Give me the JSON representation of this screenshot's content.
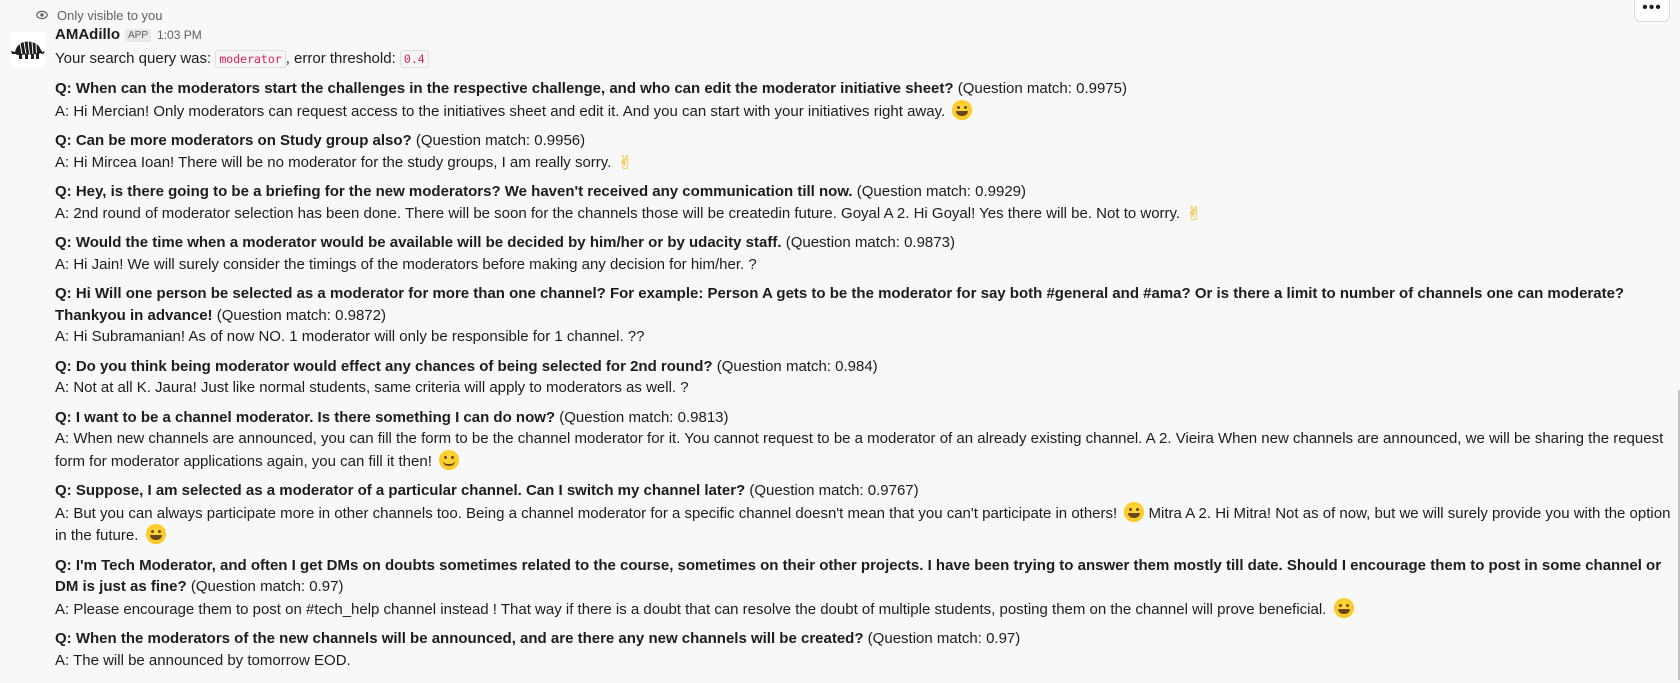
{
  "visibility_note": "Only visible to you",
  "message": {
    "sender": "AMAdillo",
    "badge": "APP",
    "time": "1:03 PM",
    "query_prefix": "Your search query was: ",
    "query_value": "moderator",
    "threshold_prefix": ", error threshold: ",
    "threshold_value": "0.4"
  },
  "more_actions_label": "•••",
  "qa": [
    {
      "q": "Q: When can the moderators start the challenges in the respective challenge, and who can edit the moderator initiative sheet?",
      "match": " (Question match: 0.9975)",
      "a": "A: Hi Mercian! Only moderators can request access to the initiatives sheet and edit it. And you can start with your initiatives right away.",
      "emoji": "grin"
    },
    {
      "q": "Q: Can be more moderators on Study group also?",
      "match": " (Question match: 0.9956)",
      "a": "A: Hi Mircea Ioan! There will be no moderator for the study groups, I am really sorry.",
      "emoji": "victory"
    },
    {
      "q": "Q: Hey, is there going to be a briefing for the new moderators? We haven't received any communication till now.",
      "match": " (Question match: 0.9929)",
      "a": "A: 2nd round of moderator selection has been done. There will be soon for the channels those will be createdin future. Goyal A 2. Hi Goyal! Yes there will be. Not to worry.",
      "emoji": "victory"
    },
    {
      "q": "Q: Would the time when a moderator would be available will be decided by him/her or by udacity staff.",
      "match": " (Question match: 0.9873)",
      "a": "A: Hi Jain! We will surely consider the timings of the moderators before making any decision for him/her. ?",
      "emoji": ""
    },
    {
      "q": "Q: Hi Will one person be selected as a moderator for more than one channel? For example: Person A gets to be the moderator for say both #general and #ama? Or is there a limit to number of channels one can moderate? Thankyou in advance!",
      "match": " (Question match: 0.9872)",
      "a": "A: Hi Subramanian! As of now NO. 1 moderator will only be responsible for 1 channel. ??",
      "emoji": ""
    },
    {
      "q": "Q: Do you think being moderator would effect any chances of being selected for 2nd round?",
      "match": " (Question match: 0.984)",
      "a": "A: Not at all K. Jaura! Just like normal students, same criteria will apply to moderators as well. ?",
      "emoji": ""
    },
    {
      "q": "Q: I want to be a channel moderator. Is there something I can do now?",
      "match": " (Question match: 0.9813)",
      "a": "A: When new channels are announced, you can fill the form to be the channel moderator for it. You cannot request to be a moderator of an already existing channel. A 2. Vieira When new channels are announced, we will be sharing the request form for moderator applications again, you can fill it then!",
      "emoji": "slight"
    },
    {
      "q": "Q: Suppose, I am selected as a moderator of a particular channel. Can I switch my channel later?",
      "match": " (Question match: 0.9767)",
      "a": "A: But you can always participate more in other channels too. Being a channel moderator for a specific channel doesn't mean that you can't participate in others!",
      "a2": " Mitra A 2. Hi Mitra! Not as of now, but we will surely provide you with the option in the future.",
      "emoji": "grin"
    },
    {
      "q": "Q: I'm Tech Moderator, and often I get DMs on doubts sometimes related to the course, sometimes on their other projects. I have been trying to answer them mostly till date. Should I encourage them to post in some channel or DM is just as fine?",
      "match": " (Question match: 0.97)",
      "a": "A: Please encourage them to post on #tech_help channel instead ! That way if there is a doubt that can resolve the doubt of multiple students, posting them on the channel will prove beneficial.",
      "emoji": "grin"
    },
    {
      "q": "Q: When the moderators of the new channels will be announced, and are there any new channels will be created?",
      "match": " (Question match: 0.97)",
      "a": "A: The will be announced by tomorrow EOD.",
      "emoji": ""
    }
  ],
  "icons": {
    "eye": "eye-icon",
    "avatar": "armadillo-avatar",
    "emoji_grin": "grinning-face-emoji",
    "emoji_slight": "slightly-smiling-face-emoji",
    "emoji_victory": "victory-hand-emoji"
  },
  "colors": {
    "code_text": "#e01e5a",
    "background": "#f8f8f8",
    "muted": "#616061"
  }
}
